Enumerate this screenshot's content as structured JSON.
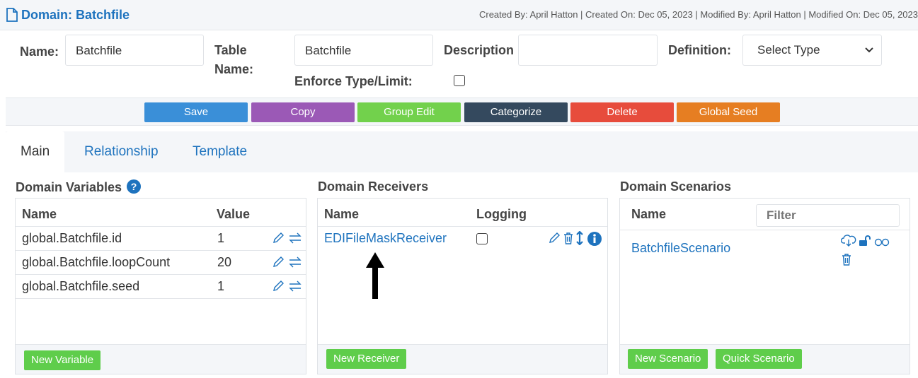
{
  "header": {
    "title": "Domain: Batchfile",
    "meta": "Created By: April Hatton | Created On: Dec 05, 2023 | Modified By: April Hatton | Modified On: Dec 05, 2023"
  },
  "form": {
    "name_label": "Name:",
    "name_value": "Batchfile",
    "table_name_label_1": "Table",
    "table_name_label_2": "Name:",
    "table_name_value": "Batchfile",
    "description_label": "Description",
    "description_value": "",
    "definition_label": "Definition:",
    "definition_selected": "Select Type",
    "enforce_label": "Enforce Type/Limit:",
    "enforce_checked": false
  },
  "actions": {
    "save": "Save",
    "copy": "Copy",
    "group_edit": "Group Edit",
    "categorize": "Categorize",
    "delete": "Delete",
    "global_seed": "Global Seed"
  },
  "colors": {
    "save": "#3a8fd8",
    "copy": "#9b59b6",
    "group_edit": "#72d14c",
    "categorize": "#34495e",
    "delete": "#e74c3c",
    "global_seed": "#e67e22",
    "link": "#1e73be",
    "green_button": "#5fcd4b"
  },
  "tabs": [
    {
      "label": "Main",
      "active": true
    },
    {
      "label": "Relationship",
      "active": false
    },
    {
      "label": "Template",
      "active": false
    }
  ],
  "variables": {
    "title": "Domain Variables",
    "help_icon": "question-circle-icon",
    "col_name": "Name",
    "col_value": "Value",
    "rows": [
      {
        "name": "global.Batchfile.id",
        "value": "1"
      },
      {
        "name": "global.Batchfile.loopCount",
        "value": "20"
      },
      {
        "name": "global.Batchfile.seed",
        "value": "1"
      }
    ],
    "new_button": "New Variable"
  },
  "receivers": {
    "title": "Domain Receivers",
    "col_name": "Name",
    "col_logging": "Logging",
    "rows": [
      {
        "name": "EDIFileMaskReceiver",
        "logging": false
      }
    ],
    "new_button": "New Receiver"
  },
  "scenarios": {
    "title": "Domain Scenarios",
    "col_name": "Name",
    "filter_placeholder": "Filter",
    "rows": [
      {
        "name": "BatchfileScenario"
      }
    ],
    "new_button": "New Scenario",
    "quick_button": "Quick Scenario"
  }
}
